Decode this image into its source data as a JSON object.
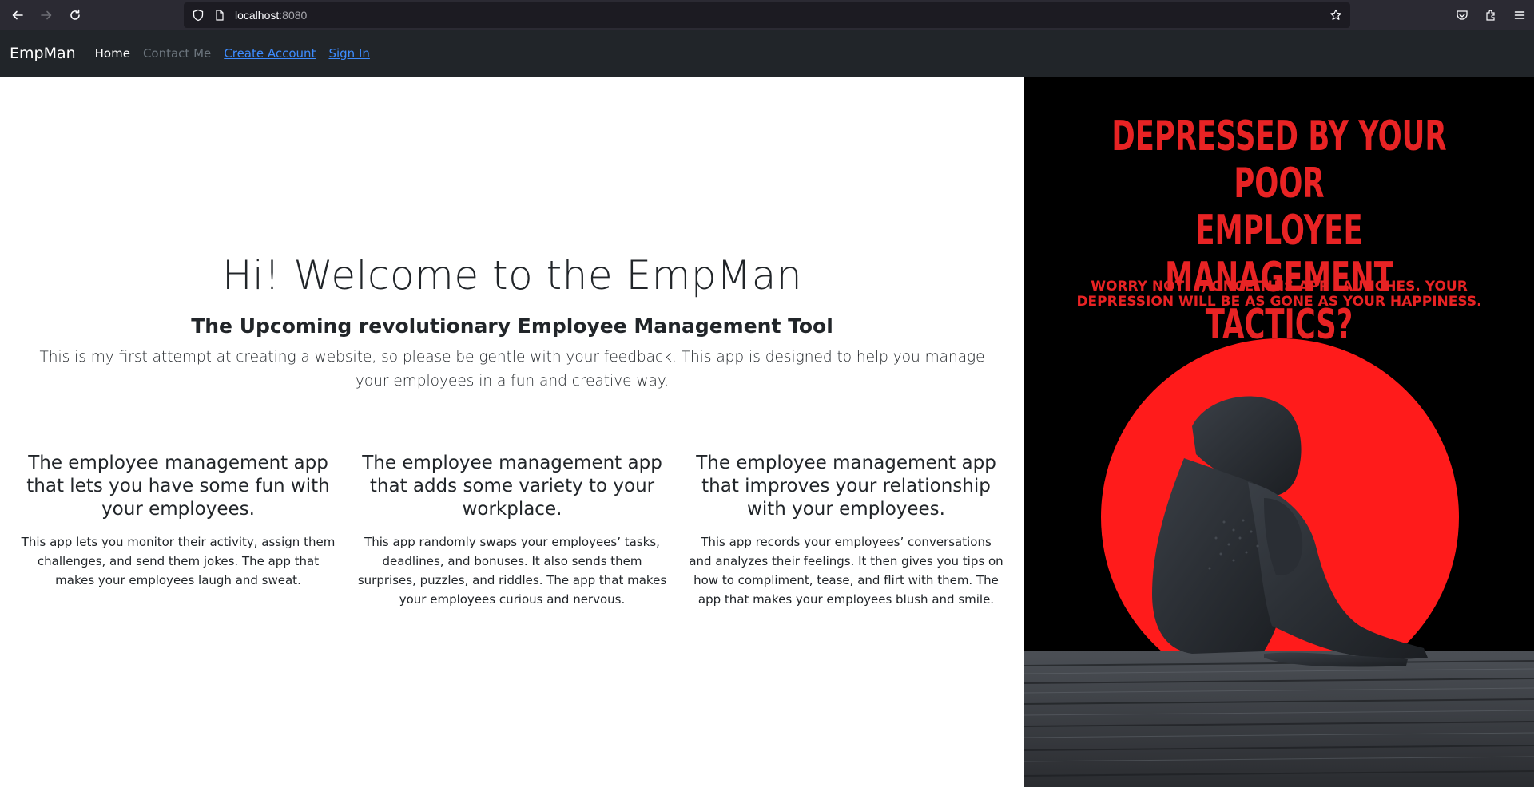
{
  "browser": {
    "url_host": "localhost",
    "url_port": ":8080"
  },
  "navbar": {
    "brand": "EmpMan",
    "links": [
      {
        "label": "Home"
      },
      {
        "label": "Contact Me"
      },
      {
        "label": "Create Account"
      },
      {
        "label": "Sign In"
      }
    ]
  },
  "hero": {
    "title": "Hi! Welcome to the EmpMan",
    "subtitle": "The Upcoming revolutionary Employee Management Tool",
    "lead": "This is my first attempt at creating a website, so please be gentle with your feedback. This app is designed to help you manage your employees in a fun and creative way."
  },
  "features": [
    {
      "title": "The employee management app that lets you have some fun with your employees.",
      "text": "This app lets you monitor their activity, assign them challenges, and send them jokes. The app that makes your employees laugh and sweat."
    },
    {
      "title": "The employee management app that adds some variety to your workplace.",
      "text": "This app randomly swaps your employees’ tasks, deadlines, and bonuses. It also sends them surprises, puzzles, and riddles. The app that makes your employees curious and nervous."
    },
    {
      "title": "The employee management app that improves your relationship with your employees.",
      "text": "This app records your employees’ conversations and analyzes their feelings. It then gives you tips on how to compliment, tease, and flirt with them. The app that makes your employees blush and smile."
    }
  ],
  "poster": {
    "headline_lines": [
      "DEPRESSED BY YOUR POOR",
      "EMPLOYEE MANAGEMENT",
      "TACTICS?"
    ],
    "subline": "WORRY NOT! :) ONCE THIS APP LAUNCHES. YOUR DEPRESSION WILL BE AS GONE AS YOUR HAPPINESS."
  },
  "colors": {
    "navbar_bg": "#212529",
    "link_blue": "#3d8bfd",
    "poster_red": "#e82324",
    "poster_circle": "#ff1b1b"
  }
}
